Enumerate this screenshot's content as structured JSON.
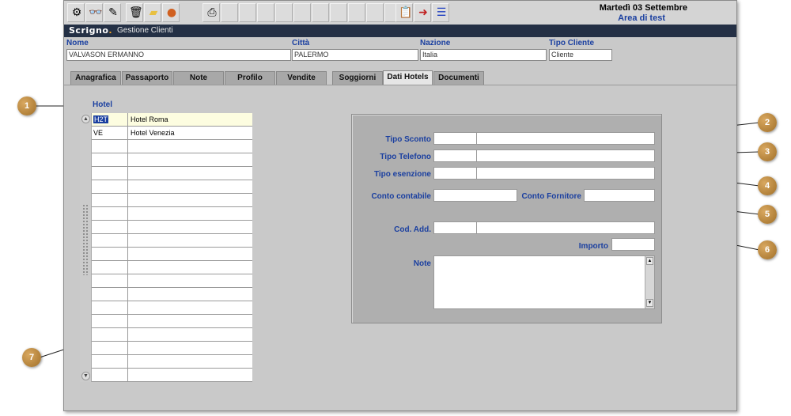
{
  "header_right": {
    "date": "Martedì 03 Settembre",
    "environment": "Area di test"
  },
  "titlebar": {
    "logo": "Scrigno",
    "module": "Gestione Clienti"
  },
  "toolbar": {
    "icons": [
      "tools-icon",
      "glasses-icon",
      "edit-icon",
      "trash-icon",
      "folder-icon",
      "user-icon",
      "printer-icon",
      "empty",
      "empty",
      "empty",
      "empty",
      "empty",
      "empty",
      "empty",
      "empty",
      "empty",
      "empty",
      "report-icon",
      "exit-icon",
      "list-icon"
    ]
  },
  "customer": {
    "nome_label": "Nome",
    "nome_value": "VALVASON ERMANNO",
    "citta_label": "Città",
    "citta_value": "PALERMO",
    "nazione_label": "Nazione",
    "nazione_value": "Italia",
    "tipo_label": "Tipo Cliente",
    "tipo_value": "Cliente"
  },
  "tabs": [
    {
      "label": "Anagrafica"
    },
    {
      "label": "Passaporto"
    },
    {
      "label": "Note"
    },
    {
      "label": "Profilo"
    },
    {
      "label": "Vendite"
    },
    {
      "label": "Soggiorni"
    },
    {
      "label": "Dati Hotels",
      "active": true
    },
    {
      "label": "Documenti"
    }
  ],
  "hotels": {
    "header": "Hotel",
    "rows": [
      {
        "code": "H2T",
        "name": "Hotel Roma"
      },
      {
        "code": "VE",
        "name": "Hotel Venezia"
      }
    ]
  },
  "detail": {
    "tipo_sconto": "Tipo Sconto",
    "tipo_telefono": "Tipo Telefono",
    "tipo_esenzione": "Tipo esenzione",
    "conto_contabile": "Conto contabile",
    "conto_fornitore": "Conto Fornitore",
    "cod_add": "Cod. Add.",
    "importo": "Importo",
    "note": "Note"
  },
  "callouts": [
    "1",
    "2",
    "3",
    "4",
    "5",
    "6",
    "7"
  ],
  "colors": {
    "label_blue": "#1a3fa0",
    "titlebar": "#243045",
    "callout": "#b88440"
  }
}
